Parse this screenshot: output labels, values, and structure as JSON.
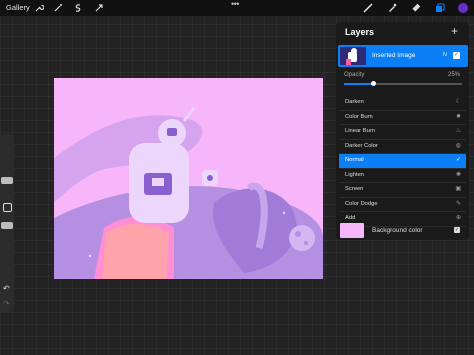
{
  "topbar": {
    "gallery_label": "Gallery",
    "more_label": "•••",
    "left_tools": [
      "wrench-icon",
      "magic-wand-icon",
      "selection-icon",
      "transform-arrow-icon"
    ],
    "right_tools": [
      "brush-icon",
      "smudge-icon",
      "eraser-icon",
      "layers-icon"
    ],
    "active_color": "#6a2fc9"
  },
  "layers_panel": {
    "title": "Layers",
    "add_symbol": "+",
    "layer": {
      "name": "Inserted Image",
      "blend_abbrev": "N",
      "visible_mark": "✓"
    },
    "opacity_label": "Opacity",
    "opacity_value": "25%",
    "opacity_fraction": 0.25,
    "blend_modes": [
      {
        "label": "Darken",
        "icon": "☾"
      },
      {
        "label": "Color Burn",
        "icon": "✹"
      },
      {
        "label": "Linear Burn",
        "icon": "♨"
      },
      {
        "label": "Darker Color",
        "icon": "◍"
      },
      {
        "label": "Normal",
        "icon": "✓",
        "selected": true
      },
      {
        "label": "Lighten",
        "icon": "✺"
      },
      {
        "label": "Screen",
        "icon": "▣"
      },
      {
        "label": "Color Dodge",
        "icon": "✎"
      },
      {
        "label": "Add",
        "icon": "⊕"
      }
    ],
    "background": {
      "label": "Background color",
      "visible_mark": "✓",
      "color": "#f7b6fa"
    }
  },
  "sidebar": {
    "undo_symbol": "↶",
    "redo_symbol": "↷"
  },
  "colors": {
    "accent": "#0a7ff6",
    "canvas_bg": "#f7b6fa",
    "figure": "#b691e6"
  }
}
